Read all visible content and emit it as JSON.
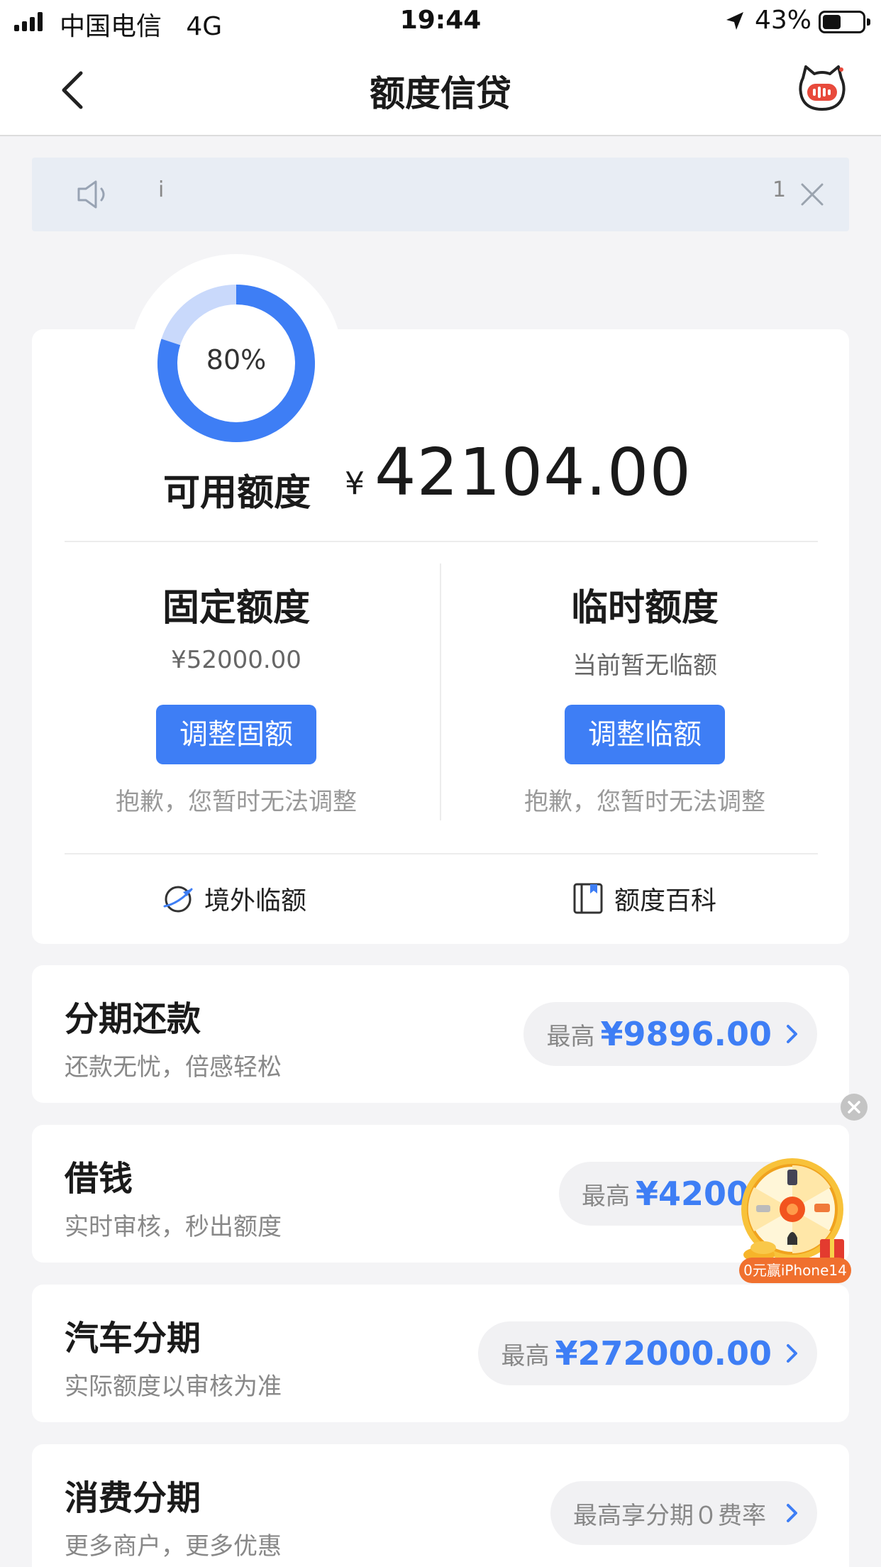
{
  "status_bar": {
    "carrier": "中国电信",
    "network": "4G",
    "time": "19:44",
    "battery": "43%"
  },
  "nav": {
    "title": "额度信贷",
    "back_icon": "chevron-left-icon",
    "mascot_icon": "cat-mascot-icon"
  },
  "notice": {
    "marquee_text_left": "i",
    "marquee_text_right": "1"
  },
  "credit": {
    "usage_percent": "80%",
    "usage_fraction": 0.8,
    "available_label": "可用额度",
    "currency": "¥",
    "available_amount": "42104.00",
    "fixed": {
      "title": "固定额度",
      "amount": "¥52000.00",
      "button": "调整固额",
      "note": "抱歉，您暂时无法调整"
    },
    "temporary": {
      "title": "临时额度",
      "amount": "当前暂无临额",
      "button": "调整临额",
      "note": "抱歉，您暂时无法调整"
    },
    "links": {
      "overseas": "境外临额",
      "wiki": "额度百科"
    }
  },
  "products": [
    {
      "title": "分期还款",
      "subtitle": "还款无忧，倍感轻松",
      "prefix": "最高",
      "amount": "¥9896.00"
    },
    {
      "title": "借钱",
      "subtitle": "实时审核，秒出额度",
      "prefix": "最高",
      "amount": "¥42000"
    },
    {
      "title": "汽车分期",
      "subtitle": "实际额度以审核为准",
      "prefix": "最高",
      "amount": "¥272000.00"
    },
    {
      "title": "消费分期",
      "subtitle": "更多商户，更多优惠",
      "prefix": "最高享分期０费率",
      "amount": ""
    }
  ],
  "promo": {
    "label": "0元赢iPhone14"
  },
  "colors": {
    "accent": "#3e7ef5",
    "ring_track": "#c9d9fb",
    "background": "#f4f4f6"
  }
}
